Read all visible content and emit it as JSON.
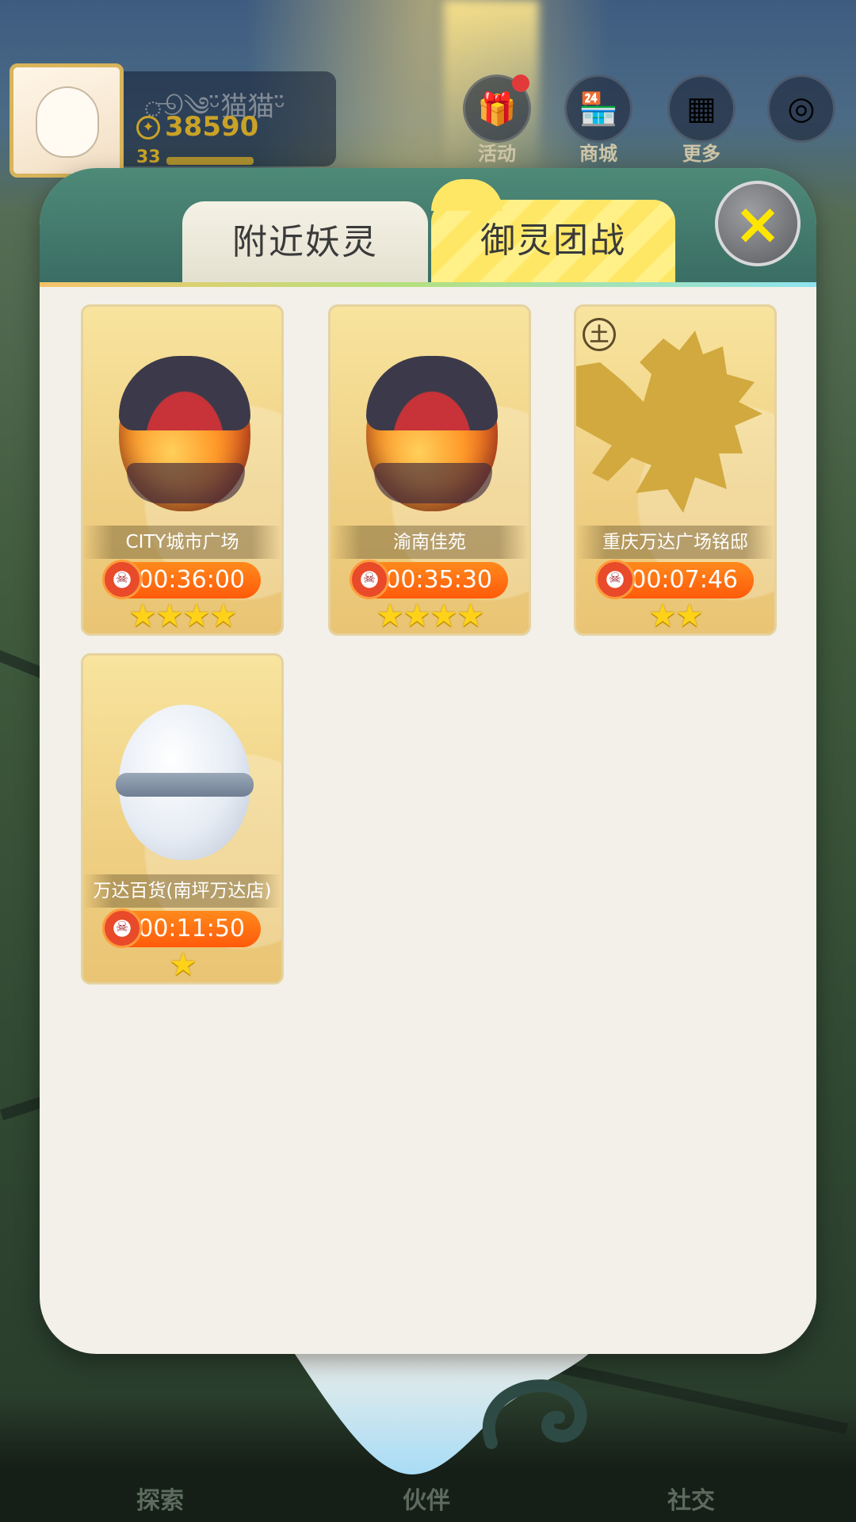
{
  "hud": {
    "player_name": "ூ༄ᵕ̈猫猫ᵕ̈",
    "coins": "38590",
    "level": "33",
    "buttons": [
      {
        "label": "活动",
        "icon": "gift-icon"
      },
      {
        "label": "商城",
        "icon": "shop-icon"
      },
      {
        "label": "更多",
        "icon": "grid-icon"
      },
      {
        "label": "",
        "icon": "compass-icon"
      }
    ]
  },
  "modal": {
    "tabs": [
      {
        "label": "附近妖灵",
        "active": false
      },
      {
        "label": "御灵团战",
        "active": true
      }
    ],
    "close_icon": "×"
  },
  "raids": [
    {
      "location": "CITY城市广场",
      "timer": "00:36:00",
      "stars": 4,
      "stars_text": "★★★★",
      "egg": "red"
    },
    {
      "location": "渝南佳苑",
      "timer": "00:35:30",
      "stars": 4,
      "stars_text": "★★★★",
      "egg": "red"
    },
    {
      "location": "重庆万达广场铭邸",
      "timer": "00:07:46",
      "stars": 2,
      "stars_text": "★★",
      "egg": "silhouette",
      "element": "土"
    },
    {
      "location": "万达百货(南坪万达店)",
      "timer": "00:11:50",
      "stars": 1,
      "stars_text": "★",
      "egg": "white"
    }
  ],
  "bottom_nav": [
    {
      "label": "探索"
    },
    {
      "label": "伙伴"
    },
    {
      "label": "社交"
    }
  ],
  "colors": {
    "tab_active": "#ffe766",
    "timer": "#ff5a0a",
    "star": "#ffd21a",
    "close_x": "#ffe600"
  }
}
